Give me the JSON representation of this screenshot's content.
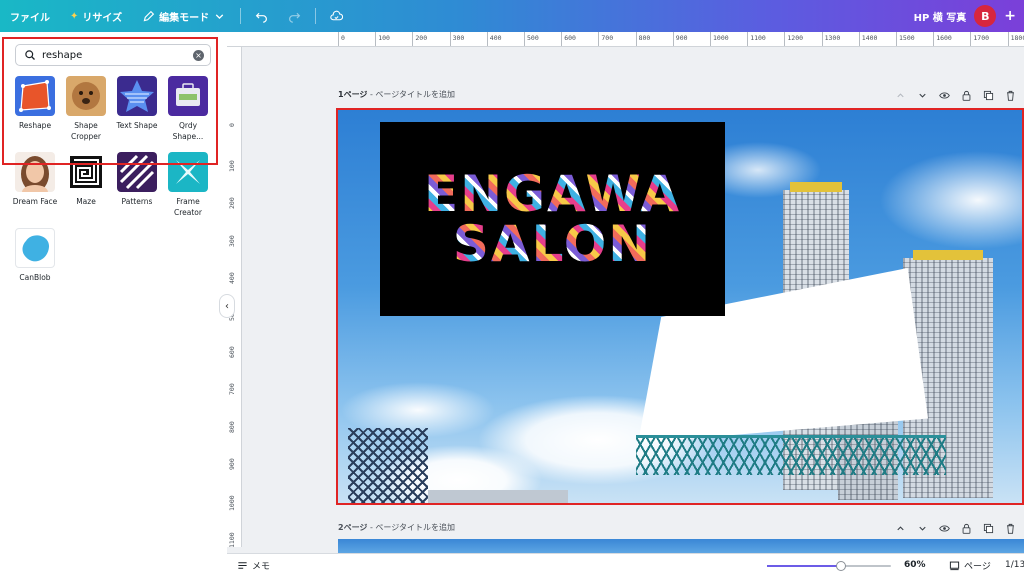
{
  "topbar": {
    "file": "ファイル",
    "resize": "リサイズ",
    "edit_mode": "編集モード",
    "title": "HP 横 写真",
    "avatar_initial": "B",
    "accent": "#6c5ce7"
  },
  "search": {
    "value": "reshape",
    "placeholder": ""
  },
  "apps": [
    {
      "label": "Reshape",
      "icon": "reshape-app-icon"
    },
    {
      "label": "Shape Cropper",
      "icon": "shape-cropper-app-icon"
    },
    {
      "label": "Text Shape",
      "icon": "text-shape-app-icon"
    },
    {
      "label": "Qrdy Shape...",
      "icon": "qrdy-shape-app-icon"
    },
    {
      "label": "Dream Face",
      "icon": "dream-face-app-icon"
    },
    {
      "label": "Maze",
      "icon": "maze-app-icon"
    },
    {
      "label": "Patterns",
      "icon": "patterns-app-icon"
    },
    {
      "label": "Frame Creator",
      "icon": "frame-creator-app-icon"
    },
    {
      "label": "CanBlob",
      "icon": "canblob-app-icon"
    }
  ],
  "ruler_top": [
    "0",
    "100",
    "200",
    "300",
    "400",
    "500",
    "600",
    "700",
    "800",
    "900",
    "1000",
    "1100",
    "1200",
    "1300",
    "1400",
    "1500",
    "1600",
    "1700",
    "1800"
  ],
  "ruler_left": [
    "0",
    "100",
    "200",
    "300",
    "400",
    "500",
    "600",
    "700",
    "800",
    "900",
    "1000",
    "1100"
  ],
  "page1": {
    "number": "1ページ",
    "title_hint": "- ページタイトルを追加",
    "logo_line1": "ENGAWA",
    "logo_line2": "SALON"
  },
  "page2": {
    "number": "2ページ",
    "title_hint": "- ページタイトルを追加"
  },
  "bottombar": {
    "memo": "メモ",
    "zoom": "60%",
    "zoom_fraction": 0.6,
    "pages": "ページ",
    "page_count": "1/13"
  }
}
